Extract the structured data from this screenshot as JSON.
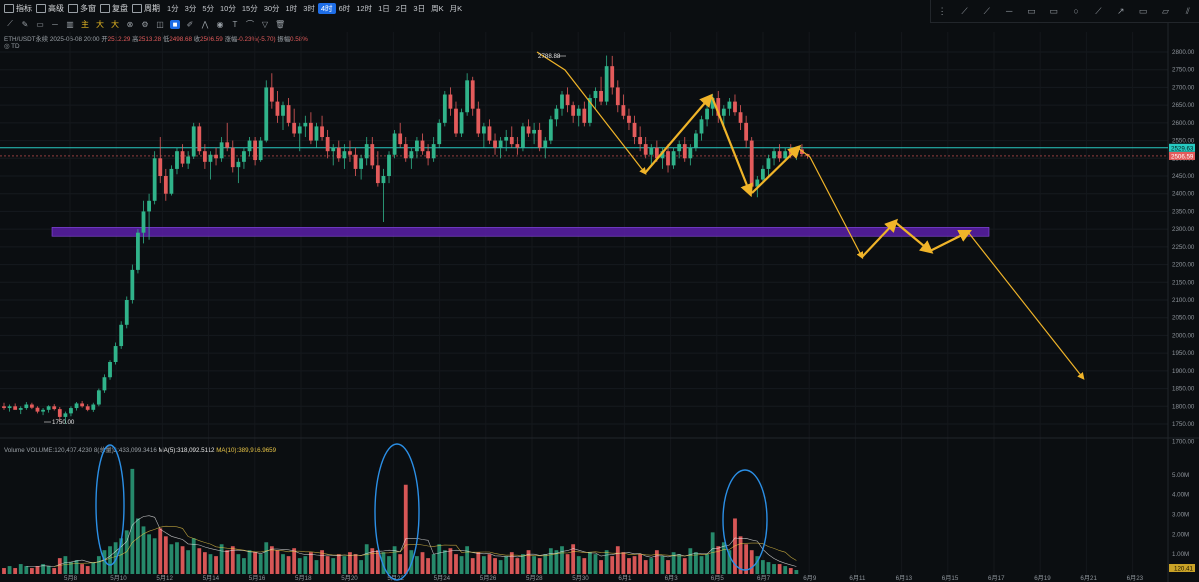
{
  "toolbar": {
    "items": [
      "指标",
      "高级",
      "多窗",
      "复盘",
      "周期"
    ],
    "intervals": [
      "1分",
      "3分",
      "5分",
      "10分",
      "15分",
      "30分",
      "1时",
      "3时",
      "4时",
      "6时",
      "12时",
      "1日",
      "2日",
      "3日",
      "周K",
      "月K"
    ],
    "active_interval": "4时",
    "tools2": [
      "主",
      "大",
      "大"
    ]
  },
  "draw_tools": [
    "grid-icon",
    "line-icon",
    "ray-icon",
    "hline-icon",
    "rect-icon",
    "rect2-icon",
    "circle-icon",
    "trend-icon",
    "arrow-icon",
    "rect3-icon",
    "para-icon",
    "fib-icon"
  ],
  "legend": {
    "symbol": "ETH/USDT永续",
    "date": "2025-06-08 20:00",
    "open_label": "开",
    "open": "2512.29",
    "high_label": "高",
    "high": "2513.28",
    "low_label": "低",
    "low": "2498.68",
    "close_label": "收",
    "close": "2506.59",
    "change_label": "涨幅",
    "change": "-0.23%(-5.70)",
    "amp_label": "振幅",
    "amp": "0.58%",
    "td_label": "TD"
  },
  "volume_legend": {
    "label": "Volume",
    "vol": "VOLUME:120,407.4230",
    "vol2": "8(总量)2:433,099.3416",
    "ma5": "MA(5):318,092.5112",
    "ma10": "MA(10):389,916.9659"
  },
  "price_labels": {
    "high_marker": "2788.88",
    "low_marker": "1750.00",
    "cyan_line": "2529.63",
    "last_price": "2506.59",
    "volume_last": "120.41"
  },
  "colors": {
    "up": "#30b38a",
    "down": "#e35b5b",
    "cyan": "#27c9c1",
    "zone": "#5b1fa8",
    "arrow": "#f0b429",
    "ellipse": "#2b8fe6",
    "ma5": "#e8e8e8",
    "ma10": "#e8c547"
  },
  "chart_data": {
    "type": "candlestick",
    "symbol": "ETH/USDT永续",
    "interval": "4时",
    "y_ticks": [
      1700,
      1750,
      1800,
      1850,
      1900,
      1950,
      2000,
      2050,
      2100,
      2150,
      2200,
      2250,
      2300,
      2350,
      2400,
      2450,
      2500,
      2550,
      2600,
      2650,
      2700,
      2750,
      2800
    ],
    "ylim": [
      1680,
      2830
    ],
    "x_ticks": [
      "5月8",
      "5月10",
      "5月12",
      "5月14",
      "5月16",
      "5月18",
      "5月20",
      "5月22",
      "5月24",
      "5月26",
      "5月28",
      "5月30",
      "6月1",
      "6月3",
      "6月5",
      "6月7",
      "6月9",
      "6月11",
      "6月13",
      "6月15",
      "6月17",
      "6月19",
      "6月21",
      "6月23"
    ],
    "candles": [
      [
        1800,
        1810,
        1790,
        1795
      ],
      [
        1795,
        1805,
        1785,
        1800
      ],
      [
        1800,
        1808,
        1792,
        1790
      ],
      [
        1790,
        1800,
        1778,
        1795
      ],
      [
        1795,
        1812,
        1790,
        1805
      ],
      [
        1805,
        1810,
        1792,
        1796
      ],
      [
        1796,
        1800,
        1780,
        1785
      ],
      [
        1785,
        1795,
        1775,
        1790
      ],
      [
        1790,
        1803,
        1782,
        1800
      ],
      [
        1800,
        1806,
        1788,
        1792
      ],
      [
        1792,
        1798,
        1760,
        1770
      ],
      [
        1770,
        1785,
        1750,
        1780
      ],
      [
        1780,
        1800,
        1772,
        1795
      ],
      [
        1795,
        1812,
        1788,
        1808
      ],
      [
        1808,
        1815,
        1796,
        1800
      ],
      [
        1800,
        1806,
        1786,
        1790
      ],
      [
        1790,
        1810,
        1784,
        1805
      ],
      [
        1805,
        1850,
        1800,
        1845
      ],
      [
        1845,
        1890,
        1838,
        1882
      ],
      [
        1882,
        1930,
        1875,
        1925
      ],
      [
        1925,
        1980,
        1918,
        1970
      ],
      [
        1970,
        2040,
        1962,
        2030
      ],
      [
        2030,
        2110,
        2020,
        2100
      ],
      [
        2100,
        2200,
        2090,
        2185
      ],
      [
        2185,
        2300,
        2175,
        2290
      ],
      [
        2290,
        2380,
        2260,
        2350
      ],
      [
        2350,
        2400,
        2270,
        2380
      ],
      [
        2380,
        2520,
        2370,
        2500
      ],
      [
        2500,
        2560,
        2430,
        2450
      ],
      [
        2450,
        2470,
        2380,
        2400
      ],
      [
        2400,
        2480,
        2395,
        2470
      ],
      [
        2470,
        2530,
        2455,
        2520
      ],
      [
        2520,
        2540,
        2475,
        2485
      ],
      [
        2485,
        2520,
        2470,
        2505
      ],
      [
        2505,
        2600,
        2498,
        2590
      ],
      [
        2590,
        2600,
        2510,
        2520
      ],
      [
        2520,
        2540,
        2470,
        2490
      ],
      [
        2490,
        2520,
        2440,
        2510
      ],
      [
        2510,
        2530,
        2480,
        2500
      ],
      [
        2500,
        2560,
        2490,
        2545
      ],
      [
        2545,
        2600,
        2520,
        2530
      ],
      [
        2530,
        2550,
        2460,
        2475
      ],
      [
        2475,
        2500,
        2430,
        2490
      ],
      [
        2490,
        2530,
        2470,
        2520
      ],
      [
        2520,
        2560,
        2505,
        2550
      ],
      [
        2550,
        2560,
        2480,
        2495
      ],
      [
        2495,
        2560,
        2490,
        2550
      ],
      [
        2550,
        2720,
        2545,
        2700
      ],
      [
        2700,
        2740,
        2640,
        2660
      ],
      [
        2660,
        2690,
        2600,
        2620
      ],
      [
        2620,
        2660,
        2580,
        2650
      ],
      [
        2650,
        2670,
        2590,
        2600
      ],
      [
        2600,
        2640,
        2560,
        2570
      ],
      [
        2570,
        2600,
        2520,
        2590
      ],
      [
        2590,
        2620,
        2560,
        2600
      ],
      [
        2600,
        2630,
        2540,
        2550
      ],
      [
        2550,
        2600,
        2530,
        2590
      ],
      [
        2590,
        2620,
        2550,
        2560
      ],
      [
        2560,
        2580,
        2500,
        2520
      ],
      [
        2520,
        2540,
        2480,
        2530
      ],
      [
        2530,
        2550,
        2490,
        2500
      ],
      [
        2500,
        2540,
        2470,
        2520
      ],
      [
        2520,
        2550,
        2490,
        2510
      ],
      [
        2510,
        2530,
        2450,
        2470
      ],
      [
        2470,
        2510,
        2440,
        2500
      ],
      [
        2500,
        2560,
        2480,
        2540
      ],
      [
        2540,
        2560,
        2470,
        2480
      ],
      [
        2480,
        2520,
        2420,
        2430
      ],
      [
        2430,
        2470,
        2320,
        2450
      ],
      [
        2450,
        2520,
        2430,
        2510
      ],
      [
        2510,
        2580,
        2500,
        2570
      ],
      [
        2570,
        2600,
        2530,
        2540
      ],
      [
        2540,
        2560,
        2490,
        2500
      ],
      [
        2500,
        2530,
        2470,
        2520
      ],
      [
        2520,
        2560,
        2500,
        2550
      ],
      [
        2550,
        2570,
        2510,
        2520
      ],
      [
        2520,
        2540,
        2480,
        2500
      ],
      [
        2500,
        2560,
        2490,
        2540
      ],
      [
        2540,
        2610,
        2530,
        2600
      ],
      [
        2600,
        2690,
        2590,
        2680
      ],
      [
        2680,
        2700,
        2620,
        2640
      ],
      [
        2640,
        2660,
        2560,
        2570
      ],
      [
        2570,
        2640,
        2560,
        2630
      ],
      [
        2630,
        2740,
        2620,
        2720
      ],
      [
        2720,
        2730,
        2620,
        2640
      ],
      [
        2640,
        2660,
        2560,
        2570
      ],
      [
        2570,
        2600,
        2530,
        2590
      ],
      [
        2590,
        2610,
        2540,
        2550
      ],
      [
        2550,
        2570,
        2510,
        2530
      ],
      [
        2530,
        2560,
        2500,
        2550
      ],
      [
        2550,
        2580,
        2520,
        2560
      ],
      [
        2560,
        2590,
        2530,
        2540
      ],
      [
        2540,
        2560,
        2510,
        2530
      ],
      [
        2530,
        2600,
        2520,
        2590
      ],
      [
        2590,
        2610,
        2560,
        2570
      ],
      [
        2570,
        2600,
        2540,
        2580
      ],
      [
        2580,
        2600,
        2520,
        2530
      ],
      [
        2530,
        2560,
        2500,
        2550
      ],
      [
        2550,
        2620,
        2540,
        2610
      ],
      [
        2610,
        2650,
        2590,
        2640
      ],
      [
        2640,
        2690,
        2620,
        2680
      ],
      [
        2680,
        2700,
        2630,
        2650
      ],
      [
        2650,
        2660,
        2600,
        2620
      ],
      [
        2620,
        2650,
        2590,
        2640
      ],
      [
        2640,
        2660,
        2590,
        2600
      ],
      [
        2600,
        2680,
        2590,
        2670
      ],
      [
        2670,
        2700,
        2640,
        2690
      ],
      [
        2690,
        2730,
        2650,
        2660
      ],
      [
        2660,
        2790,
        2650,
        2760
      ],
      [
        2760,
        2789,
        2680,
        2700
      ],
      [
        2700,
        2720,
        2630,
        2650
      ],
      [
        2650,
        2680,
        2610,
        2620
      ],
      [
        2620,
        2640,
        2580,
        2600
      ],
      [
        2600,
        2620,
        2540,
        2560
      ],
      [
        2560,
        2590,
        2520,
        2540
      ],
      [
        2540,
        2560,
        2500,
        2510
      ],
      [
        2510,
        2540,
        2480,
        2530
      ],
      [
        2530,
        2550,
        2490,
        2500
      ],
      [
        2500,
        2530,
        2470,
        2520
      ],
      [
        2520,
        2540,
        2460,
        2480
      ],
      [
        2480,
        2530,
        2470,
        2520
      ],
      [
        2520,
        2550,
        2500,
        2540
      ],
      [
        2540,
        2560,
        2490,
        2500
      ],
      [
        2500,
        2540,
        2480,
        2530
      ],
      [
        2530,
        2580,
        2520,
        2570
      ],
      [
        2570,
        2620,
        2550,
        2610
      ],
      [
        2610,
        2650,
        2590,
        2640
      ],
      [
        2640,
        2680,
        2620,
        2670
      ],
      [
        2670,
        2690,
        2600,
        2620
      ],
      [
        2620,
        2650,
        2580,
        2640
      ],
      [
        2640,
        2670,
        2620,
        2660
      ],
      [
        2660,
        2680,
        2620,
        2630
      ],
      [
        2630,
        2650,
        2580,
        2600
      ],
      [
        2600,
        2620,
        2530,
        2550
      ],
      [
        2550,
        2560,
        2400,
        2420
      ],
      [
        2420,
        2450,
        2390,
        2440
      ],
      [
        2440,
        2480,
        2430,
        2470
      ],
      [
        2470,
        2510,
        2450,
        2500
      ],
      [
        2500,
        2530,
        2480,
        2520
      ],
      [
        2520,
        2540,
        2490,
        2500
      ],
      [
        2500,
        2530,
        2490,
        2520
      ],
      [
        2520,
        2540,
        2500,
        2510
      ],
      [
        2510,
        2530,
        2495,
        2525
      ],
      [
        2525,
        2540,
        2505,
        2512
      ],
      [
        2512,
        2513,
        2499,
        2507
      ]
    ],
    "volumes_m": [
      0.3,
      0.4,
      0.3,
      0.5,
      0.4,
      0.3,
      0.4,
      0.5,
      0.4,
      0.3,
      0.8,
      0.9,
      0.6,
      0.7,
      0.5,
      0.4,
      0.6,
      0.9,
      1.2,
      1.4,
      1.6,
      1.8,
      2.2,
      5.3,
      2.8,
      2.4,
      2.0,
      1.8,
      2.3,
      1.9,
      1.5,
      1.6,
      1.4,
      1.2,
      1.8,
      1.3,
      1.1,
      1.0,
      0.9,
      1.5,
      1.2,
      1.4,
      1.0,
      0.8,
      1.2,
      1.1,
      1.0,
      1.6,
      1.4,
      1.2,
      1.0,
      0.9,
      1.3,
      0.8,
      0.9,
      1.1,
      0.7,
      1.2,
      0.9,
      0.8,
      1.0,
      0.9,
      1.1,
      1.0,
      0.7,
      1.5,
      1.3,
      1.2,
      1.1,
      0.9,
      1.4,
      1.0,
      4.5,
      1.2,
      0.9,
      1.1,
      0.8,
      1.0,
      1.5,
      1.2,
      1.3,
      1.0,
      0.9,
      1.4,
      0.8,
      1.1,
      0.9,
      1.0,
      0.8,
      0.7,
      0.9,
      1.1,
      0.8,
      1.0,
      1.2,
      0.9,
      0.8,
      1.0,
      1.3,
      1.2,
      1.4,
      1.0,
      1.5,
      0.9,
      0.8,
      1.1,
      1.0,
      0.7,
      1.2,
      0.9,
      1.4,
      1.1,
      0.8,
      0.9,
      1.0,
      0.7,
      0.8,
      1.2,
      0.9,
      0.7,
      1.1,
      1.0,
      0.8,
      1.3,
      1.1,
      0.9,
      1.0,
      2.1,
      1.4,
      1.6,
      1.2,
      2.8,
      1.9,
      1.5,
      1.2,
      0.9,
      0.7,
      0.6,
      0.5,
      0.5,
      0.4,
      0.3,
      0.2
    ],
    "volume_ticks_m": [
      1,
      2,
      3,
      4,
      5
    ],
    "support_zone": [
      2280,
      2305
    ],
    "cyan_level": 2529.63,
    "forecast_path": [
      [
        2518,
        2505
      ],
      [
        2460,
        2205
      ],
      [
        2442,
        2325
      ],
      [
        2413,
        2230
      ],
      [
        2405,
        2295
      ],
      [
        2348,
        1880
      ]
    ]
  }
}
